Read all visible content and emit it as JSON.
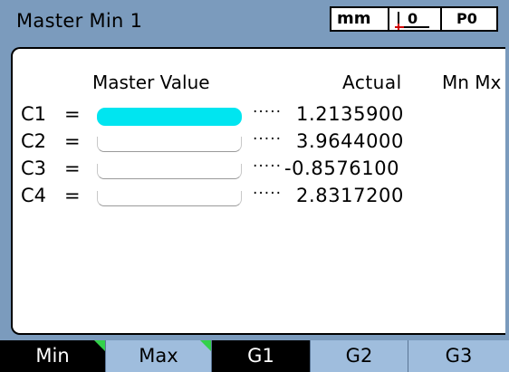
{
  "title_bar": {
    "title": "Master Min 1",
    "units": "mm",
    "zero_indicator": "0",
    "part": "P0"
  },
  "main": {
    "headers": {
      "master_value": "Master Value",
      "actual": "Actual",
      "mn_mx": "Mn Mx"
    },
    "rows": [
      {
        "label": "C1",
        "eq": "=",
        "master_value": "",
        "dots": "·····",
        "actual": "1.2135900",
        "selected": true
      },
      {
        "label": "C2",
        "eq": "=",
        "master_value": "",
        "dots": "·····",
        "actual": "3.9644000",
        "selected": false
      },
      {
        "label": "C3",
        "eq": "=",
        "master_value": "",
        "dots": "·····",
        "actual": "-0.8576100",
        "selected": false
      },
      {
        "label": "C4",
        "eq": "=",
        "master_value": "",
        "dots": "·····",
        "actual": "2.8317200",
        "selected": false
      }
    ]
  },
  "tabs": [
    {
      "label": "Min",
      "active": true,
      "flag": true
    },
    {
      "label": "Max",
      "active": false,
      "flag": true
    },
    {
      "label": "G1",
      "active": true,
      "flag": false
    },
    {
      "label": "G2",
      "active": false,
      "flag": false
    },
    {
      "label": "G3",
      "active": false,
      "flag": false
    }
  ],
  "colors": {
    "background": "#7b9bbd",
    "selected_field": "#00e5f0",
    "tab_inactive": "#9fbddd",
    "tab_active": "#000000",
    "tab_flag": "#33d14a"
  }
}
